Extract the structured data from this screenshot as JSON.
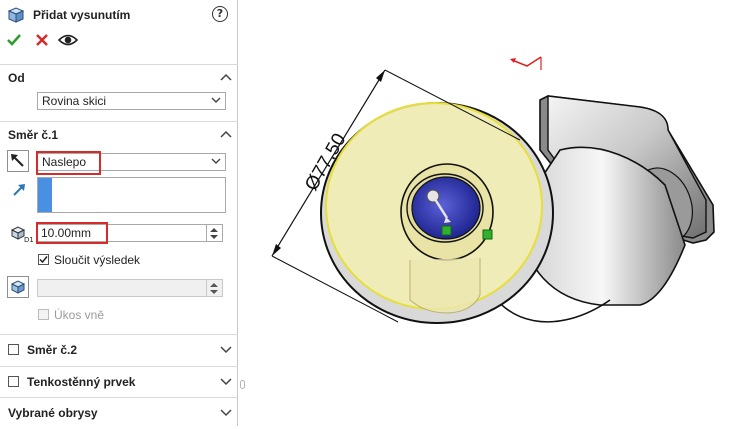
{
  "header": {
    "title": "Přidat vysunutím"
  },
  "from": {
    "section_title": "Od",
    "selected": "Rovina skici"
  },
  "direction1": {
    "section_title": "Směr č.1",
    "end_condition": "Naslepo",
    "depth_value": "10.00mm",
    "merge_result_label": "Sloučit výsledek",
    "merge_result_checked": true,
    "draft_outward_label": "Úkos vně",
    "draft_outward_checked": false
  },
  "direction2": {
    "section_title": "Směr č.2",
    "checked": false
  },
  "thin_feature": {
    "section_title": "Tenkostěnný prvek",
    "checked": false
  },
  "selected_contours": {
    "section_title": "Vybrané obrysy"
  },
  "viewport": {
    "dimension_label": "Ø77,50"
  },
  "colors": {
    "confirm": "#2e9b2e",
    "cancel": "#d62b2b",
    "highlight_box": "#d62b2b",
    "selection_accent": "#4a90e2",
    "preview_fill": "#f3efb0",
    "preview_edge": "#e6de3a"
  },
  "icons": {
    "feature": "extrude-feature-icon",
    "help": "help-icon",
    "confirm": "checkmark-icon",
    "cancel": "close-icon",
    "preview": "eye-icon"
  }
}
